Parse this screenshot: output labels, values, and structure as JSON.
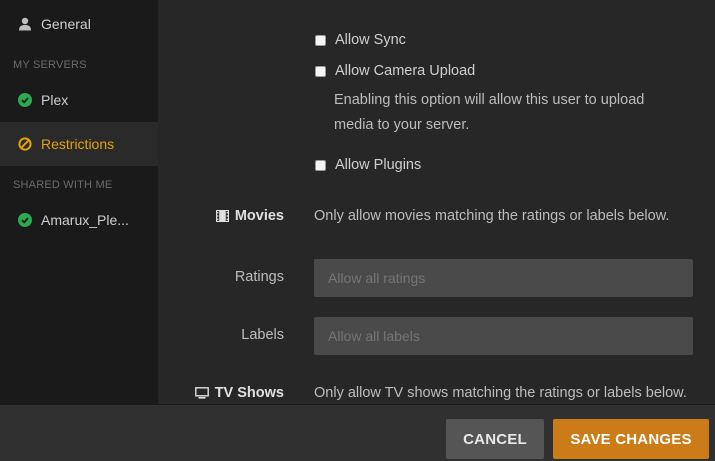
{
  "sidebar": {
    "general": {
      "label": "General",
      "icon": "user-icon"
    },
    "my_servers_header": "MY SERVERS",
    "plex": {
      "label": "Plex",
      "icon": "check-circle-icon",
      "color": "#2da94f"
    },
    "restrictions": {
      "label": "Restrictions",
      "icon": "ban-icon",
      "color": "#e5a00d",
      "active": true
    },
    "shared_header": "SHARED WITH ME",
    "amarux": {
      "label": "Amarux_Ple...",
      "icon": "check-circle-icon",
      "color": "#2da94f"
    }
  },
  "main": {
    "allow_sync": {
      "label": "Allow Sync",
      "checked": false
    },
    "allow_camera_upload": {
      "label": "Allow Camera Upload",
      "checked": false,
      "description": "Enabling this option will allow this user to upload media to your server."
    },
    "allow_plugins": {
      "label": "Allow Plugins",
      "checked": false
    },
    "movies": {
      "label": "Movies",
      "icon": "film-icon",
      "description": "Only allow movies matching the ratings or labels below.",
      "ratings_label": "Ratings",
      "ratings_placeholder": "Allow all ratings",
      "labels_label": "Labels",
      "labels_placeholder": "Allow all labels"
    },
    "tv_shows": {
      "label": "TV Shows",
      "icon": "tv-icon",
      "description": "Only allow TV shows matching the ratings or labels below."
    }
  },
  "footer": {
    "cancel_label": "CANCEL",
    "save_label": "SAVE CHANGES"
  },
  "colors": {
    "accent": "#e5a00d",
    "save_button": "#cc7b19",
    "check_green": "#2da94f"
  }
}
